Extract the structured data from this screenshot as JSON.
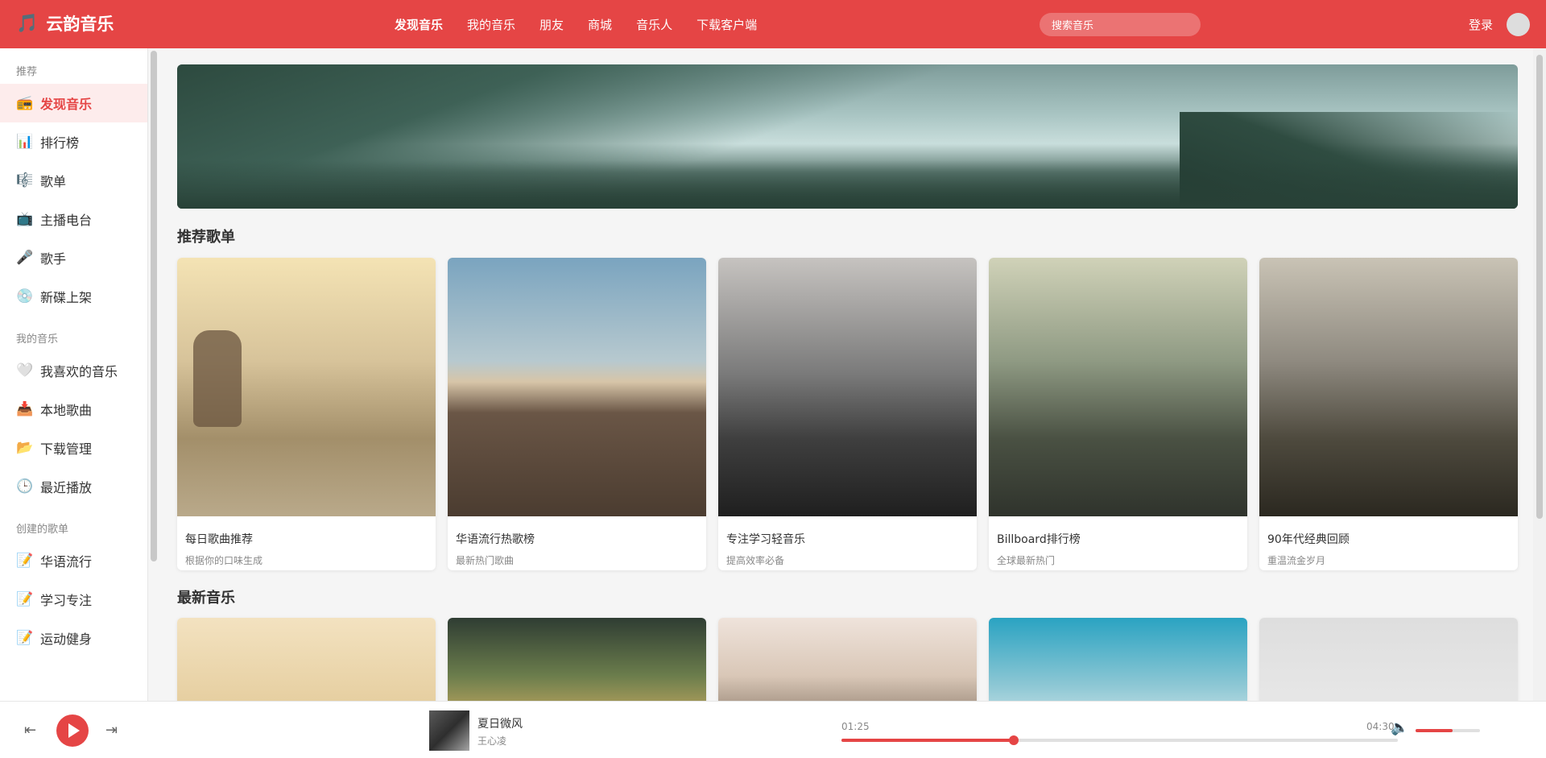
{
  "header": {
    "logo": "云韵音乐",
    "logo_icon": "music-note-icon",
    "nav": [
      "发现音乐",
      "我的音乐",
      "朋友",
      "商城",
      "音乐人",
      "下载客户端"
    ],
    "search_placeholder": "搜索音乐",
    "login": "登录"
  },
  "sidebar": {
    "sections": [
      {
        "title": "推荐",
        "items": [
          {
            "label": "发现音乐",
            "icon": "radio-icon",
            "glyph": "📻",
            "active": true
          },
          {
            "label": "排行榜",
            "icon": "chart-icon",
            "glyph": "📊"
          },
          {
            "label": "歌单",
            "icon": "playlist-icon",
            "glyph": "🎼"
          },
          {
            "label": "主播电台",
            "icon": "tv-icon",
            "glyph": "📺"
          },
          {
            "label": "歌手",
            "icon": "microphone-icon",
            "glyph": "🎤"
          },
          {
            "label": "新碟上架",
            "icon": "disc-icon",
            "glyph": "💿"
          }
        ]
      },
      {
        "title": "我的音乐",
        "items": [
          {
            "label": "我喜欢的音乐",
            "icon": "heart-icon",
            "glyph": "🤍"
          },
          {
            "label": "本地歌曲",
            "icon": "inbox-icon",
            "glyph": "📥"
          },
          {
            "label": "下载管理",
            "icon": "folder-icon",
            "glyph": "📂"
          },
          {
            "label": "最近播放",
            "icon": "clock-icon",
            "glyph": "🕒"
          }
        ]
      },
      {
        "title": "创建的歌单",
        "items": [
          {
            "label": "华语流行",
            "icon": "memo-icon",
            "glyph": "📝"
          },
          {
            "label": "学习专注",
            "icon": "memo-icon",
            "glyph": "📝"
          },
          {
            "label": "运动健身",
            "icon": "memo-icon",
            "glyph": "📝"
          }
        ]
      }
    ]
  },
  "main": {
    "recommended_title": "推荐歌单",
    "recommended": [
      {
        "title": "每日歌曲推荐",
        "subtitle": "根据你的口味生成"
      },
      {
        "title": "华语流行热歌榜",
        "subtitle": "最新热门歌曲"
      },
      {
        "title": "专注学习轻音乐",
        "subtitle": "提高效率必备"
      },
      {
        "title": "Billboard排行榜",
        "subtitle": "全球最新热门"
      },
      {
        "title": "90年代经典回顾",
        "subtitle": "重温流金岁月"
      }
    ],
    "new_music_title": "最新音乐"
  },
  "player": {
    "prev_icon": "previous-track-icon",
    "play_icon": "play-icon",
    "next_icon": "next-track-icon",
    "song_title": "夏日微风",
    "artist": "王心凌",
    "time_current": "01:25",
    "time_total": "04:30",
    "progress": 0.31,
    "volume_icon": "speaker-icon",
    "volume": 0.58,
    "accent_color": "#e54545"
  }
}
